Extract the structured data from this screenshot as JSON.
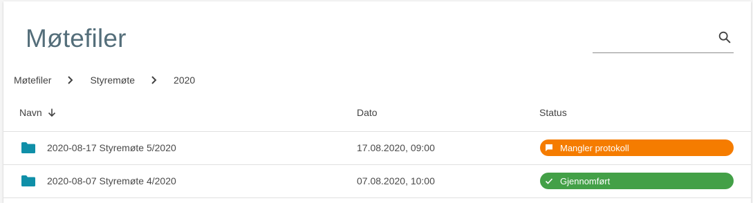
{
  "page": {
    "title": "Møtefiler"
  },
  "search": {
    "value": "",
    "placeholder": ""
  },
  "breadcrumb": {
    "items": [
      "Møtefiler",
      "Styremøte",
      "2020"
    ]
  },
  "table": {
    "columns": {
      "name": "Navn",
      "date": "Dato",
      "status": "Status"
    },
    "sort": {
      "column": "name",
      "direction": "descending"
    },
    "rows": [
      {
        "icon": "folder-icon",
        "name": "2020-08-17 Styremøte 5/2020",
        "date": "17.08.2020, 09:00",
        "status": {
          "label": "Mangler protokoll",
          "icon": "comment-icon",
          "color": "#f57c00"
        }
      },
      {
        "icon": "folder-icon",
        "name": "2020-08-07 Styremøte 4/2020",
        "date": "07.08.2020, 10:00",
        "status": {
          "label": "Gjennomført",
          "icon": "check-icon",
          "color": "#43a047"
        }
      }
    ]
  },
  "colors": {
    "title": "#546e7a",
    "folder": "#0f8fa8",
    "status_warning": "#f57c00",
    "status_success": "#43a047"
  }
}
